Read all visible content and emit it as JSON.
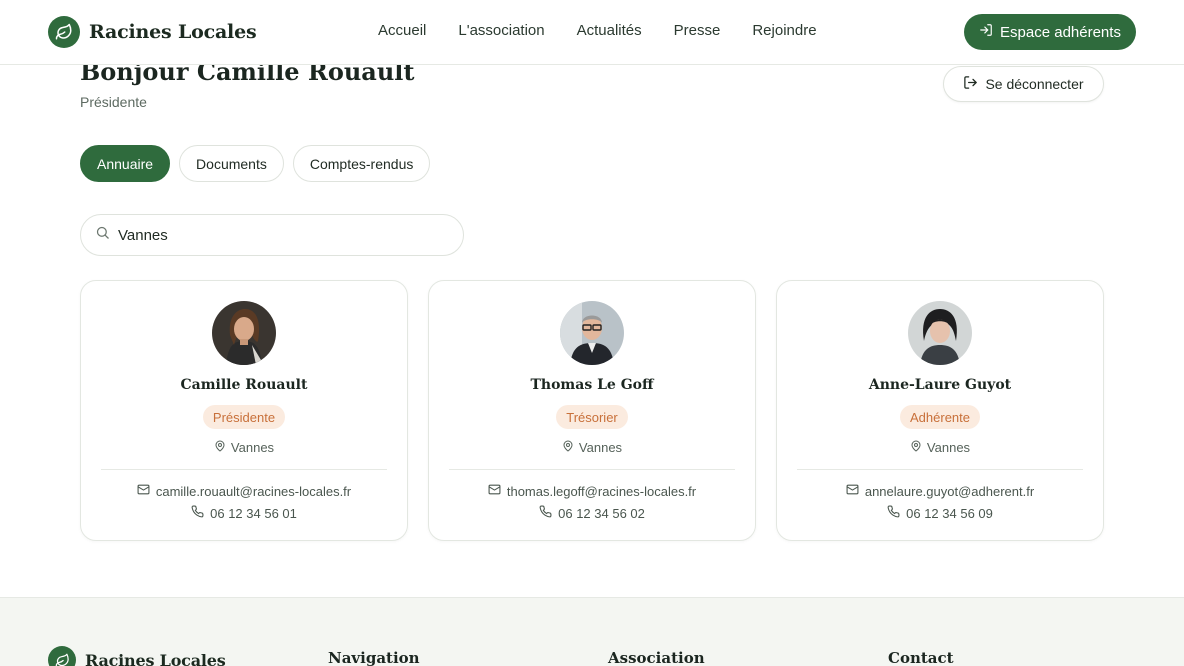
{
  "header": {
    "brand": "Racines Locales",
    "nav": [
      "Accueil",
      "L'association",
      "Actualités",
      "Presse",
      "Rejoindre"
    ],
    "members_button": "Espace adhérents"
  },
  "greeting": {
    "title": "Bonjour Camille Rouault",
    "role": "Présidente",
    "logout_label": "Se déconnecter"
  },
  "tabs": [
    {
      "label": "Annuaire",
      "active": true
    },
    {
      "label": "Documents",
      "active": false
    },
    {
      "label": "Comptes-rendus",
      "active": false
    }
  ],
  "search": {
    "value": "Vannes",
    "icon": "search-icon"
  },
  "members": [
    {
      "name": "Camille Rouault",
      "role": "Présidente",
      "city": "Vannes",
      "email": "camille.rouault@racines-locales.fr",
      "phone": "06 12 34 56 01"
    },
    {
      "name": "Thomas Le Goff",
      "role": "Trésorier",
      "city": "Vannes",
      "email": "thomas.legoff@racines-locales.fr",
      "phone": "06 12 34 56 02"
    },
    {
      "name": "Anne-Laure Guyot",
      "role": "Adhérente",
      "city": "Vannes",
      "email": "annelaure.guyot@adherent.fr",
      "phone": "06 12 34 56 09"
    }
  ],
  "footer": {
    "brand": "Racines Locales",
    "columns": [
      "Navigation",
      "Association",
      "Contact"
    ]
  },
  "colors": {
    "primary": "#2f6b3d",
    "badge_bg": "#fbebdf",
    "badge_text": "#c8703a",
    "footer_bg": "#f4f6f2"
  }
}
